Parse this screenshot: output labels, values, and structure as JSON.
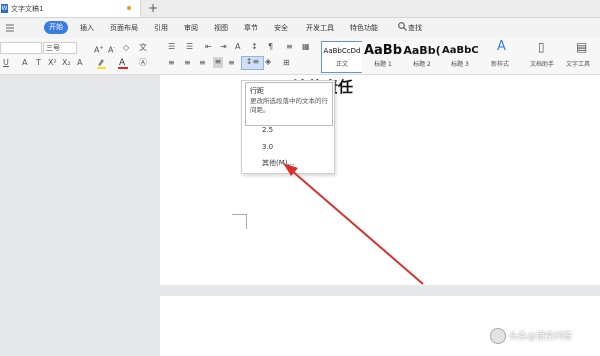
{
  "window": {
    "doc_tab": "文字文稿1",
    "new_tab": "+"
  },
  "menu": {
    "items": [
      "开始",
      "插入",
      "页面布局",
      "引用",
      "审阅",
      "视图",
      "章节",
      "安全",
      "开发工具",
      "特色功能"
    ],
    "search": "查找"
  },
  "ribbon": {
    "font_name": "",
    "font_size": "三号",
    "styles": [
      {
        "sample": "AaBbCcDd",
        "caption": "正文"
      },
      {
        "sample": "AaBb",
        "caption": "标题 1"
      },
      {
        "sample": "AaBb(",
        "caption": "标题 2"
      },
      {
        "sample": "AaBbC",
        "caption": "标题 3"
      }
    ],
    "new_style": "新样式",
    "doc_helper": "文档助手",
    "text_tools": "文字工具"
  },
  "document": {
    "heading": "法律责任"
  },
  "dropdown": {
    "tooltip_title": "行距",
    "tooltip_desc": "更改所选段落中的文本的行间距。",
    "options": [
      "2.5",
      "3.0",
      "其他(M)..."
    ]
  },
  "watermark": "头条@悟空问答",
  "colors": {
    "accent": "#3b7ce4",
    "arrow": "#d8312b"
  }
}
